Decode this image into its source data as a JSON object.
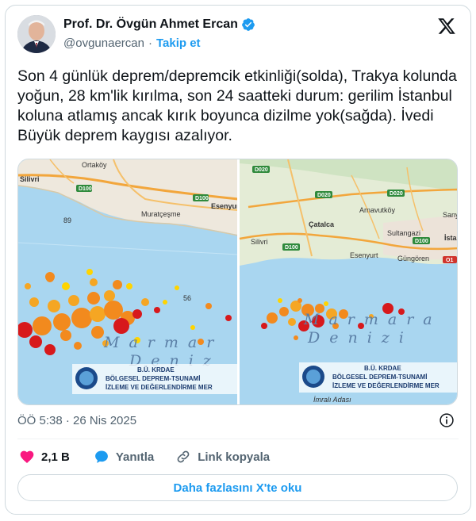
{
  "author": {
    "name": "Prof. Dr. Övgün Ahmet Ercan",
    "handle": "@ovgunaercan",
    "follow_label": "Takip et"
  },
  "icons": {
    "verified": "verified-badge-icon",
    "platform": "x-logo-icon",
    "info": "info-icon",
    "like": "heart-icon",
    "reply": "reply-bubble-icon",
    "copy_link": "link-icon"
  },
  "tweet": {
    "text": "Son 4 günlük deprem/depremcik etkinliği(solda), Trakya kolunda yoğun, 28 km'lik kırılma, son 24 saatteki durum: gerilim İstanbul koluna atlamış ancak kırık boyunca dizilme yok(sağda). İvedi Büyük deprem kaygısı azalıyor."
  },
  "media": {
    "left_map": {
      "places": [
        "Ortaköy",
        "Silivri",
        "Muratçeşme",
        "Esenyurt"
      ],
      "roads": [
        "D100",
        "D100"
      ],
      "depths": [
        "89",
        "56"
      ],
      "sea_line1": "Marmar",
      "sea_line2": "Deniz",
      "logo_line1": "B.Ü. KRDAE",
      "logo_line2": "BÖLGESEL DEPREM-TSUNAMİ",
      "logo_line3": "İZLEME VE DEĞERLENDİRME MER"
    },
    "right_map": {
      "places": [
        "Çatalca",
        "Arnavutköy",
        "Sultangazi",
        "Silivri",
        "Esenyurt",
        "Güngören",
        "İstan",
        "Sanye",
        "İmralı Adası"
      ],
      "roads": [
        "D020",
        "D020",
        "D020",
        "D100",
        "D100",
        "O1"
      ],
      "sea_line1": "Marmara",
      "sea_line2": "Denizi",
      "logo_line1": "B.Ü. KRDAE",
      "logo_line2": "BÖLGESEL DEPREM-TSUNAMİ",
      "logo_line3": "İZLEME VE DEĞERLENDİRME MER"
    }
  },
  "meta": {
    "timestamp": "ÖÖ 5:38 · 26 Nis 2025"
  },
  "actions": {
    "like_count": "2,1 B",
    "reply_label": "Yanıtla",
    "copy_label": "Link kopyala"
  },
  "footer": {
    "read_more": "Daha fazlasını X'te oku"
  },
  "colors": {
    "accent": "#1d9bf0",
    "like": "#f91880",
    "text": "#0f1419",
    "muted": "#536471"
  }
}
